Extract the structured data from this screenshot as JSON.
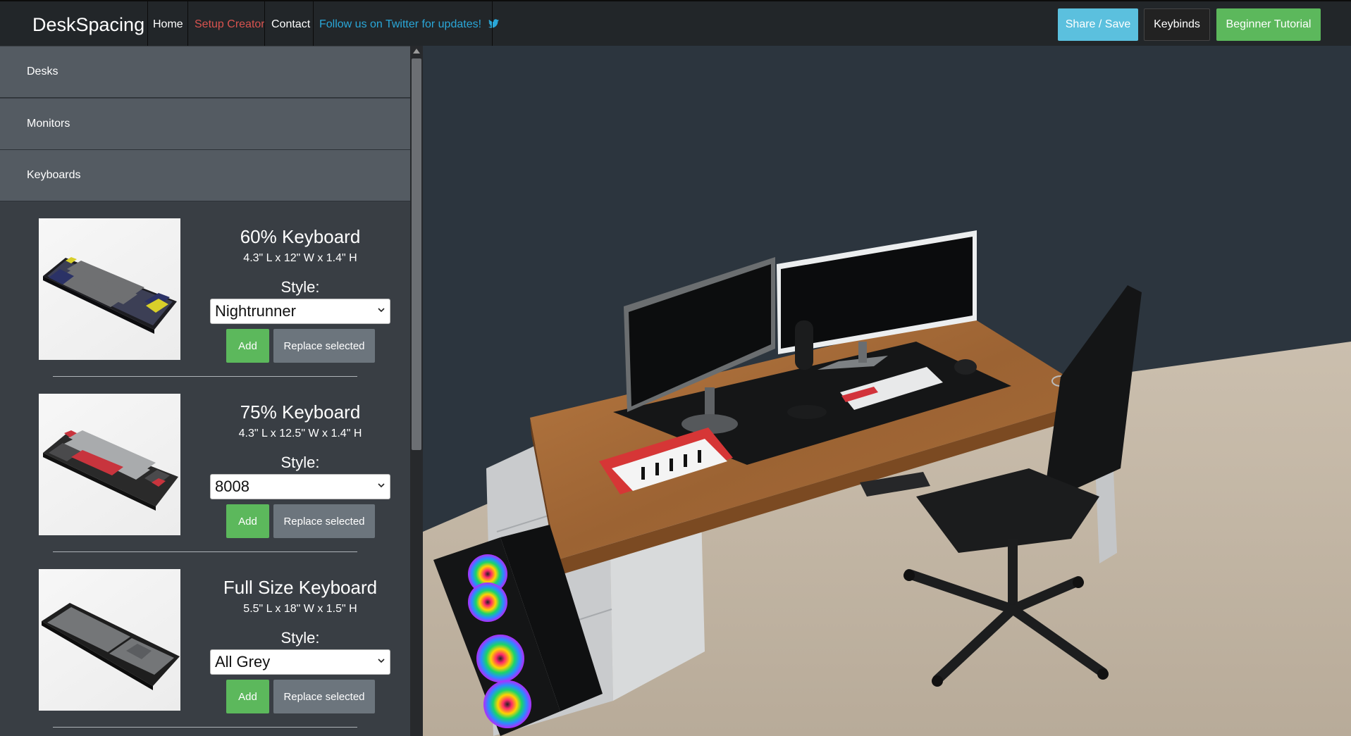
{
  "navbar": {
    "brand": "DeskSpacing",
    "links": {
      "home": "Home",
      "setup_creator": "Setup Creator",
      "contact": "Contact",
      "twitter": "Follow us on Twitter for updates!"
    },
    "buttons": {
      "share": "Share / Save",
      "keybinds": "Keybinds",
      "tutorial": "Beginner Tutorial"
    }
  },
  "sidebar": {
    "categories": [
      "Desks",
      "Monitors",
      "Keyboards"
    ],
    "style_label": "Style:",
    "add_label": "Add",
    "replace_label": "Replace selected",
    "items": [
      {
        "title": "60% Keyboard",
        "dims": "4.3\" L x 12\" W x 1.4\" H",
        "style": "Nightrunner"
      },
      {
        "title": "75% Keyboard",
        "dims": "4.3\" L x 12.5\" W x 1.4\" H",
        "style": "8008"
      },
      {
        "title": "Full Size Keyboard",
        "dims": "5.5\" L x 18\" W x 1.5\" H",
        "style": "All Grey"
      }
    ]
  },
  "colors": {
    "navbar_bg": "#222629",
    "sidebar_bg": "#393e44",
    "category_bg": "#545b62",
    "scene_bg": "#2c353e",
    "active_link": "#d9534f",
    "twitter": "#2aa7d8",
    "share_btn": "#5bc0de",
    "tutorial_btn": "#5cb85c",
    "add_btn": "#5cb85c",
    "replace_btn": "#6c757d"
  },
  "icons": [
    "twitter-icon",
    "select-caret-icon",
    "scroll-up-arrow-icon"
  ]
}
